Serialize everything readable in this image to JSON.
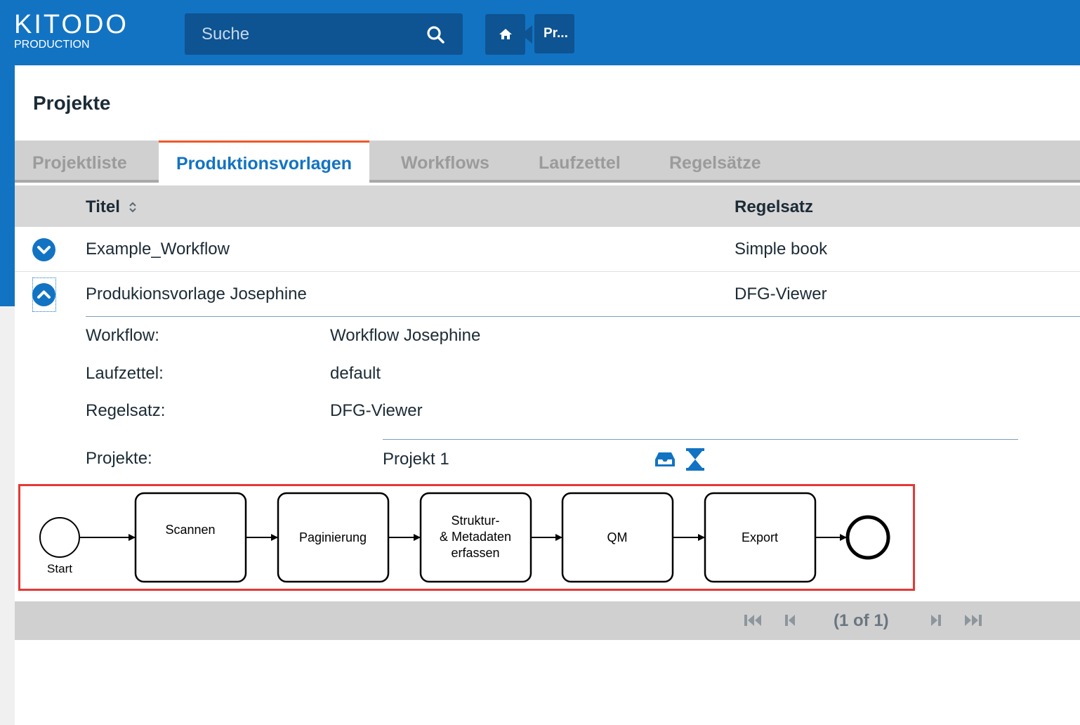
{
  "header": {
    "logo_main": "KITODO",
    "logo_sub": "PRODUCTION",
    "search_placeholder": "Suche",
    "breadcrumb_item": "Pr..."
  },
  "page": {
    "title": "Projekte"
  },
  "tabs": [
    {
      "label": "Projektliste",
      "active": false
    },
    {
      "label": "Produktionsvorlagen",
      "active": true
    },
    {
      "label": "Workflows",
      "active": false
    },
    {
      "label": "Laufzettel",
      "active": false
    },
    {
      "label": "Regelsätze",
      "active": false
    }
  ],
  "table": {
    "columns": [
      "Titel",
      "Regelsatz"
    ],
    "rows": [
      {
        "title": "Example_Workflow",
        "ruleset": "Simple book",
        "expanded": false
      },
      {
        "title": "Produkionsvorlage Josephine",
        "ruleset": "DFG-Viewer",
        "expanded": true
      }
    ]
  },
  "details": {
    "workflow_label": "Workflow:",
    "workflow_value": "Workflow Josephine",
    "docket_label": "Laufzettel:",
    "docket_value": "default",
    "ruleset_label": "Regelsatz:",
    "ruleset_value": "DFG-Viewer",
    "projects_label": "Projekte:",
    "projects": [
      "Projekt 1"
    ]
  },
  "diagram": {
    "start_label": "Start",
    "tasks": [
      "Scannen",
      "Paginierung",
      "Struktur-\n& Metadaten\nerfassen",
      "QM",
      "Export"
    ]
  },
  "pager": {
    "text": "(1 of 1)"
  },
  "colors": {
    "brand_blue": "#1273c3",
    "dark_blue": "#0e5392",
    "tab_accent": "#f0582a",
    "highlight_frame": "#e53935"
  }
}
